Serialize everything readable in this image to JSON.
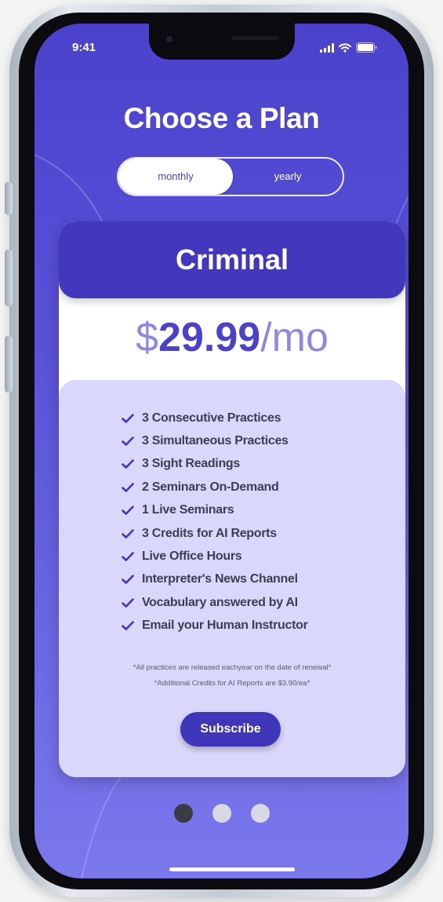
{
  "status_bar": {
    "time": "9:41",
    "icons": [
      "cellular-signal-icon",
      "wifi-icon",
      "battery-icon"
    ]
  },
  "page_title": "Choose a Plan",
  "billing_toggle": {
    "options": [
      "monthly",
      "yearly"
    ],
    "selected": "monthly"
  },
  "plan": {
    "name": "Criminal",
    "price": {
      "currency": "$",
      "amount": "29.99",
      "period": "/mo"
    },
    "features": [
      "3 Consecutive Practices",
      "3 Simultaneous Practices",
      "3 Sight Readings",
      "2 Seminars On-Demand",
      "1 Live Seminars",
      "3 Credits for AI Reports",
      "Live Office Hours",
      "Interpreter's News Channel",
      "Vocabulary answered by AI",
      "Email your Human Instructor"
    ],
    "feature_icon": "checkmark-icon",
    "fine_print": [
      "*All practices are released eachyear on the date of renewal*",
      "*Additional Credits for AI Reports are $3.90/ea*"
    ],
    "subscribe_label": "Subscribe"
  },
  "pagination": {
    "total": 3,
    "active_index": 0
  },
  "colors": {
    "screen_gradient_top": "#4b42cc",
    "screen_gradient_bottom": "#7b78ec",
    "plan_header": "#4138bd",
    "features_panel": "#dad8fa",
    "price_accent": "#4a42c9",
    "subscribe_button": "#3f36b9",
    "active_dot": "#3b3b44",
    "inactive_dot": "#d9d9e6"
  }
}
